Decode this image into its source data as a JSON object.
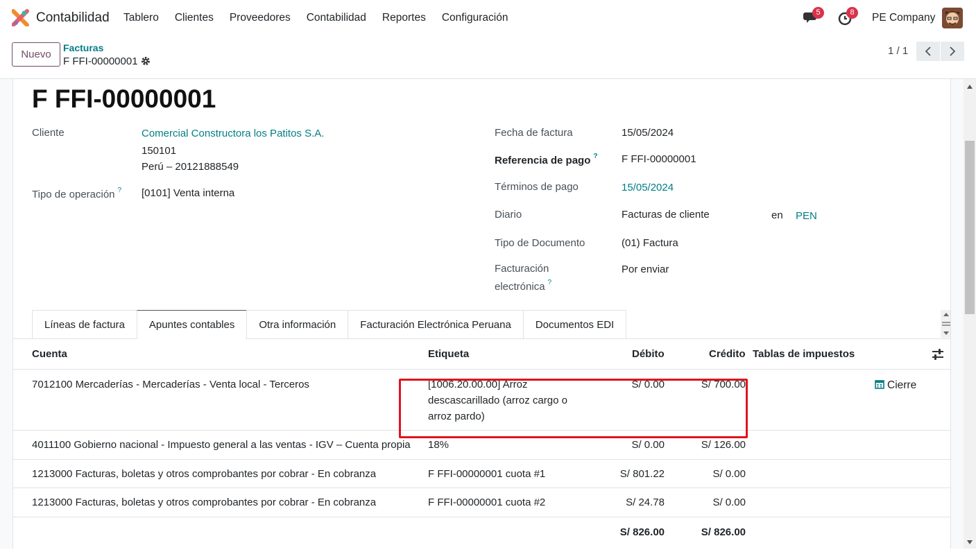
{
  "navbar": {
    "app_name": "Contabilidad",
    "menu": [
      "Tablero",
      "Clientes",
      "Proveedores",
      "Contabilidad",
      "Reportes",
      "Configuración"
    ],
    "messages_count": "5",
    "activities_count": "8",
    "company": "PE Company"
  },
  "control": {
    "new_label": "Nuevo",
    "breadcrumb_parent": "Facturas",
    "breadcrumb_current": "F FFI-00000001",
    "pager": "1 / 1"
  },
  "form": {
    "title": "F FFI-00000001",
    "cliente_label": "Cliente",
    "cliente_name": "Comercial Constructora los Patitos S.A.",
    "cliente_addr1": "150101",
    "cliente_addr2": "Perú – 20121888549",
    "tipo_op_label": "Tipo de operación",
    "tipo_op_value": "[0101] Venta interna",
    "fecha_label": "Fecha de factura",
    "fecha_value": "15/05/2024",
    "ref_label": "Referencia de pago",
    "ref_value": "F FFI-00000001",
    "terminos_label": "Términos de pago",
    "terminos_value": "15/05/2024",
    "diario_label": "Diario",
    "diario_value": "Facturas de cliente",
    "en_label": "en",
    "currency": "PEN",
    "tipo_doc_label": "Tipo de Documento",
    "tipo_doc_value": "(01) Factura",
    "fe_label_1": "Facturación",
    "fe_label_2": "electrónica",
    "fe_value": "Por enviar",
    "help_mark": "?"
  },
  "tabs": [
    "Líneas de factura",
    "Apuntes contables",
    "Otra información",
    "Facturación Electrónica Peruana",
    "Documentos EDI"
  ],
  "table": {
    "headers": {
      "cuenta": "Cuenta",
      "etiqueta": "Etiqueta",
      "debito": "Débito",
      "credito": "Crédito",
      "impuestos": "Tablas de impuestos"
    },
    "rows": [
      {
        "cuenta": "7012100 Mercaderías - Mercaderías - Venta local - Terceros",
        "etiqueta_1": "[1006.20.00.00] Arroz",
        "etiqueta_2": "descascarillado (arroz cargo o",
        "etiqueta_3": "arroz pardo)",
        "debito": "S/ 0.00",
        "credito": "S/ 700.00",
        "impuesto": "Cierre"
      },
      {
        "cuenta": "4011100 Gobierno nacional - Impuesto general a las ventas - IGV – Cuenta propia",
        "etiqueta": "18%",
        "debito": "S/ 0.00",
        "credito": "S/ 126.00"
      },
      {
        "cuenta": "1213000 Facturas, boletas y otros comprobantes por cobrar - En cobranza",
        "etiqueta": "F FFI-00000001 cuota #1",
        "debito": "S/ 801.22",
        "credito": "S/ 0.00"
      },
      {
        "cuenta": "1213000 Facturas, boletas y otros comprobantes por cobrar - En cobranza",
        "etiqueta": "F FFI-00000001 cuota #2",
        "debito": "S/ 24.78",
        "credito": "S/ 0.00"
      }
    ],
    "total_debito": "S/ 826.00",
    "total_credito": "S/ 826.00"
  },
  "colors": {
    "accent": "#017e84",
    "brand": "#714b67",
    "badge": "#d9334a",
    "highlight": "#e0141e"
  }
}
